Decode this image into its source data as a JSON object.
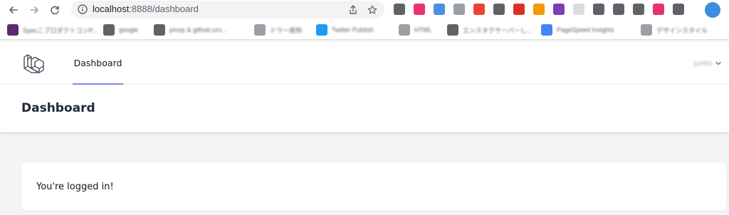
{
  "browser": {
    "url_host": "localhost",
    "url_path": ":8888/dashboard",
    "extension_colors": [
      "#5f6368",
      "#e8336a",
      "#4a90e2",
      "#9aa0a6",
      "#ea4335",
      "#5f6368",
      "#d93025",
      "#f29900",
      "#7b3fb7",
      "#dadce0",
      "#5f6368",
      "#5f6368",
      "#5f6368",
      "#e8336a",
      "#5f6368"
    ],
    "profile_color": "#3b8ee0",
    "bookmarks": [
      {
        "label": "SpecこプロダクトコンP...",
        "color": "#5b2a6e"
      },
      {
        "label": "google",
        "color": "#5f6368"
      },
      {
        "label": "pinop & github.xzv...",
        "color": "#5f6368"
      },
      {
        "label": "ドラー席例",
        "color": "#9aa0a6"
      },
      {
        "label": "Twitter Publish",
        "color": "#1d9bf0"
      },
      {
        "label": "HTML",
        "color": "#9aa0a6"
      },
      {
        "label": "エンスタクサーバーし...",
        "color": "#5f6368"
      },
      {
        "label": "PageSpeed Insights",
        "color": "#4285f4"
      },
      {
        "label": "デザインスタイル",
        "color": "#9aa0a6"
      }
    ]
  },
  "nav": {
    "dashboard_link": "Dashboard",
    "user_name": "junto",
    "active_color": "#818cf8"
  },
  "header": {
    "title": "Dashboard"
  },
  "main": {
    "message": "You're logged in!"
  }
}
